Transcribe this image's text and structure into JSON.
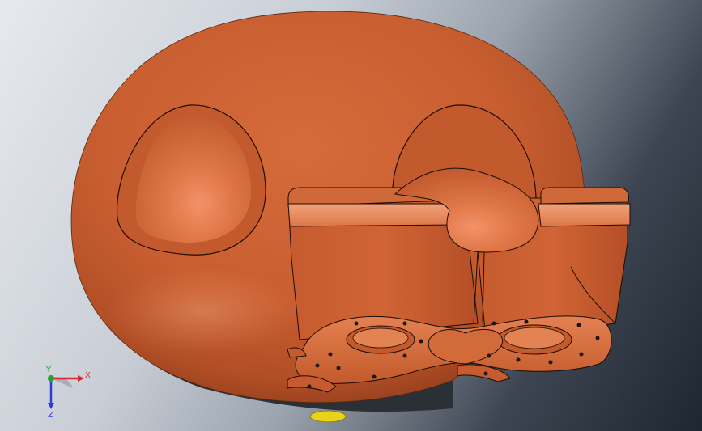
{
  "viewport": {
    "background_top": "#e6e9ee",
    "background_bottom": "#1f2630"
  },
  "model": {
    "body_color": "#cd6335",
    "highlight_color": "#e98a5e",
    "shadow_color": "#9c4424",
    "edge_color": "#2a1408",
    "yellow_part_color": "#e8d21a"
  },
  "triad": {
    "x_label": "X",
    "y_label": "Y",
    "z_label": "Z",
    "x_color": "#d62828",
    "y_color": "#1fa62a",
    "z_color": "#2a3fd6"
  }
}
